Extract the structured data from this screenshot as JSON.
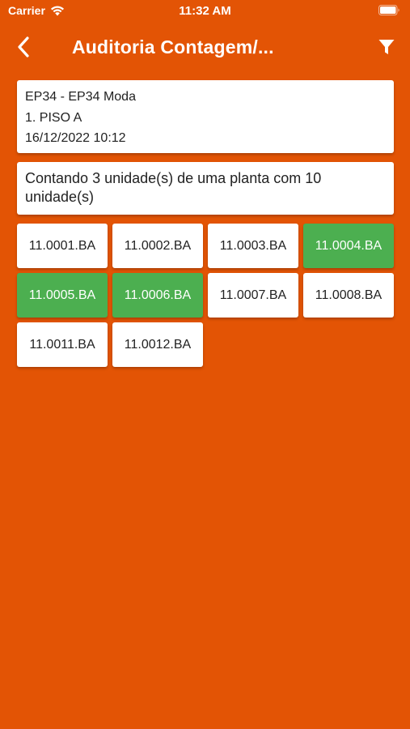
{
  "status_bar": {
    "carrier": "Carrier",
    "time": "11:32 AM",
    "wifi_icon": "wifi-icon",
    "battery_icon": "battery-icon"
  },
  "nav": {
    "title": "Auditoria Contagem/...",
    "back_icon": "chevron-left-icon",
    "filter_icon": "filter-icon"
  },
  "info": {
    "store": "EP34 - EP34 Moda",
    "floor": "1. PISO A",
    "datetime": "16/12/2022 10:12"
  },
  "count_summary": "Contando 3 unidade(s) de uma planta com 10 unidade(s)",
  "units": [
    {
      "code": "11.0001.BA",
      "counted": false
    },
    {
      "code": "11.0002.BA",
      "counted": false
    },
    {
      "code": "11.0003.BA",
      "counted": false
    },
    {
      "code": "11.0004.BA",
      "counted": true
    },
    {
      "code": "11.0005.BA",
      "counted": true
    },
    {
      "code": "11.0006.BA",
      "counted": true
    },
    {
      "code": "11.0007.BA",
      "counted": false
    },
    {
      "code": "11.0008.BA",
      "counted": false
    },
    {
      "code": "11.0011.BA",
      "counted": false
    },
    {
      "code": "11.0012.BA",
      "counted": false
    }
  ],
  "colors": {
    "background": "#e35405",
    "counted": "#4caf50",
    "card": "#ffffff",
    "text": "#222222"
  }
}
